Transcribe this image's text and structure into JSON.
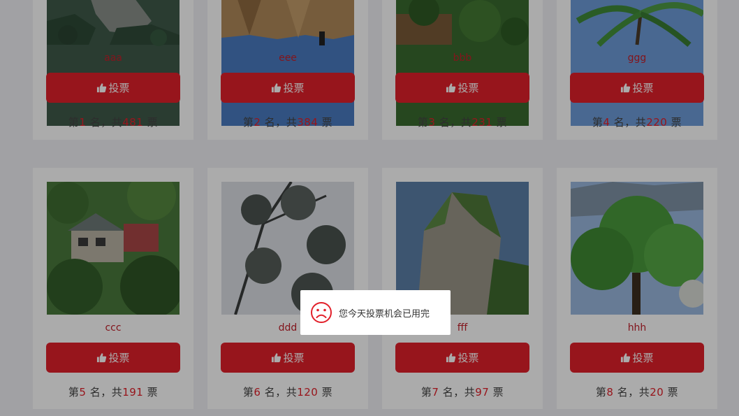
{
  "vote_label": "投票",
  "rank_parts": {
    "prefix": "第",
    "mid": "名，共",
    "suffix": "票"
  },
  "colors": {
    "accent": "#e2202a",
    "card_bg": "#ffffff",
    "page_bg": "#f0f1f5"
  },
  "candidates": [
    {
      "name": "aaa",
      "rank": "1",
      "votes": "481",
      "photo": "mountain-forest"
    },
    {
      "name": "eee",
      "rank": "2",
      "votes": "384",
      "photo": "thatched-umbrella"
    },
    {
      "name": "bbb",
      "rank": "3",
      "votes": "231",
      "photo": "greenery-wall"
    },
    {
      "name": "ggg",
      "rank": "4",
      "votes": "220",
      "photo": "palm-tree"
    },
    {
      "name": "ccc",
      "rank": "5",
      "votes": "191",
      "photo": "hillside-house"
    },
    {
      "name": "ddd",
      "rank": "6",
      "votes": "120",
      "photo": "tree-branches"
    },
    {
      "name": "fff",
      "rank": "7",
      "votes": "97",
      "photo": "karst-rock"
    },
    {
      "name": "hhh",
      "rank": "8",
      "votes": "20",
      "photo": "large-tree"
    }
  ],
  "toast": {
    "message": "您今天投票机会已用完",
    "icon": "sad-face-icon"
  }
}
